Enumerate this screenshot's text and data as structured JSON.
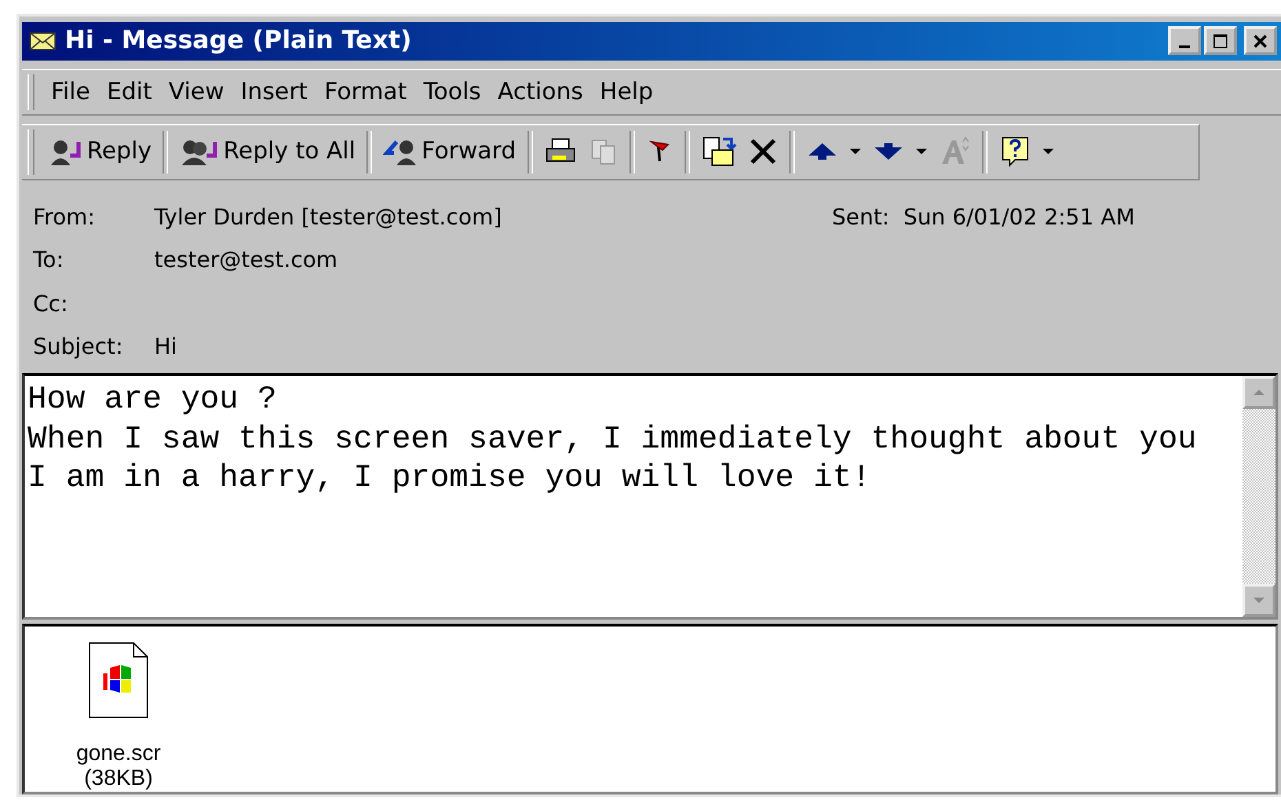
{
  "window": {
    "title": "Hi - Message (Plain Text)"
  },
  "menu": [
    "File",
    "Edit",
    "View",
    "Insert",
    "Format",
    "Tools",
    "Actions",
    "Help"
  ],
  "toolbar": {
    "buttons": [
      {
        "label": "Reply"
      },
      {
        "label": "Reply to All"
      },
      {
        "label": "Forward"
      }
    ]
  },
  "header": {
    "fields": [
      {
        "label": "From:",
        "value": "Tyler Durden [tester@test.com]"
      },
      {
        "label": "To:",
        "value": "tester@test.com"
      },
      {
        "label": "Cc:"
      },
      {
        "label": "Subject:",
        "value": "Hi"
      }
    ],
    "sent": {
      "label": "Sent:",
      "value": "Sun 6/01/02 2:51 AM"
    }
  },
  "body": {
    "lines": [
      "How are you ?",
      "When I saw this screen saver, I immediately thought about you",
      "I am in a harry, I promise you will love it!"
    ]
  },
  "attachments": [
    {
      "name": "gone.scr",
      "size": "(38KB)"
    }
  ]
}
